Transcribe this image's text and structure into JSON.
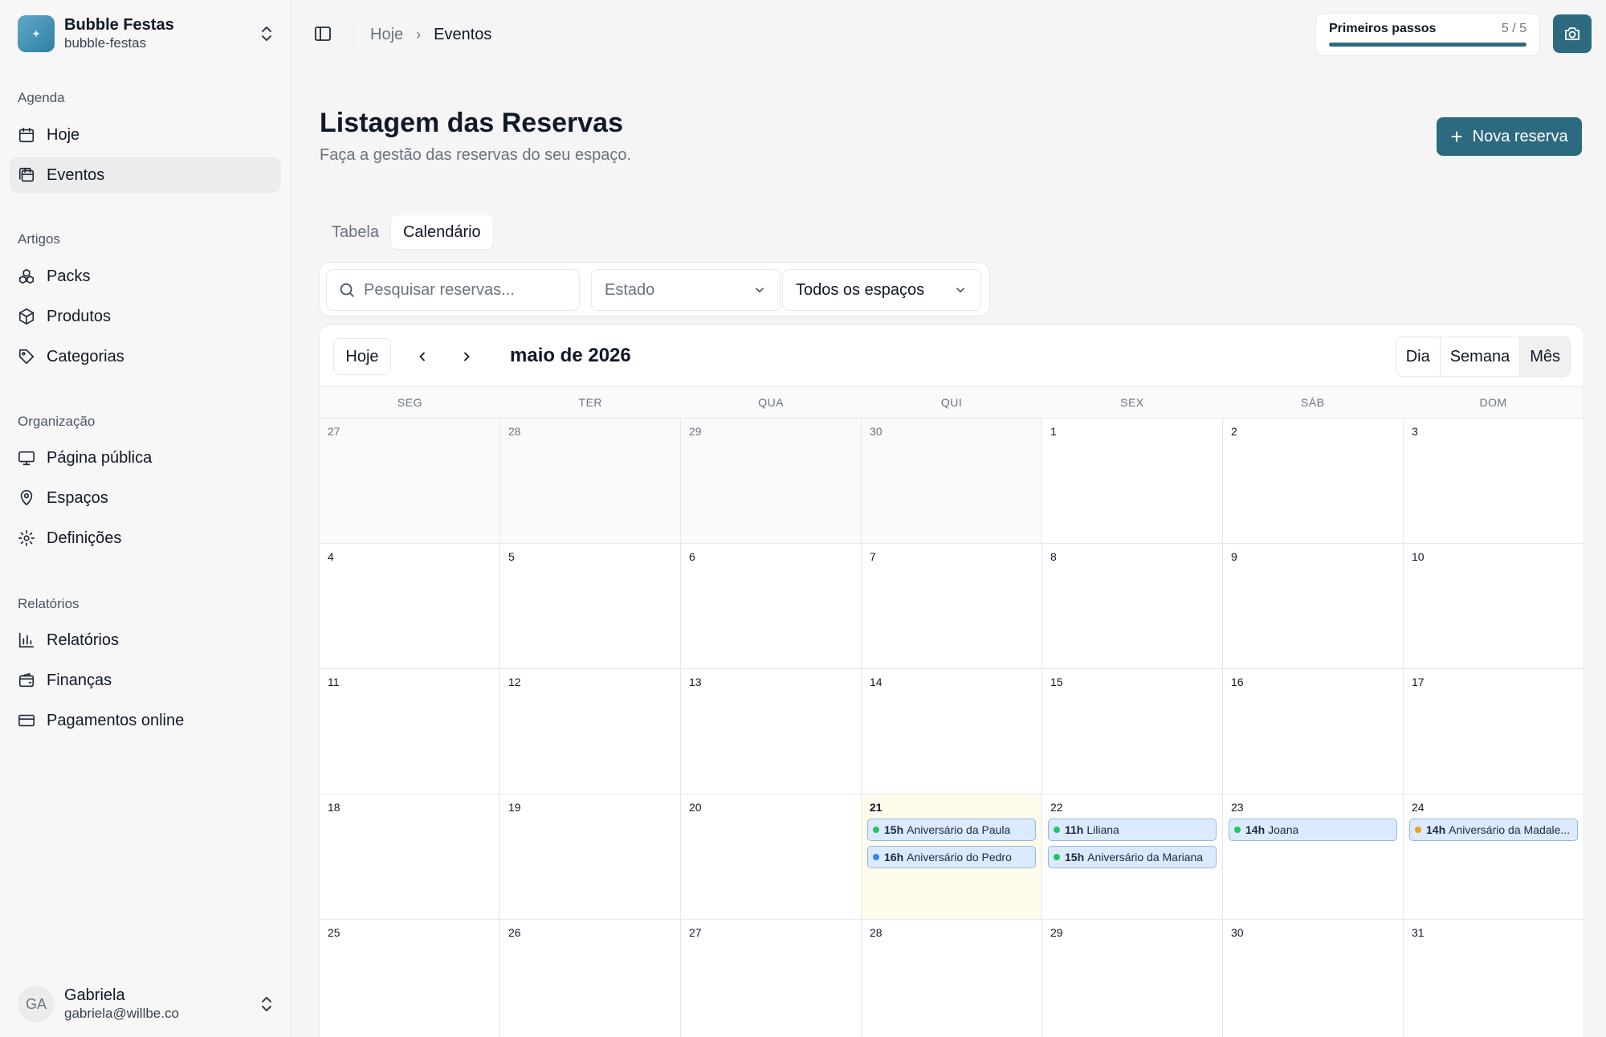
{
  "org": {
    "name": "Bubble Festas",
    "slug": "bubble-festas"
  },
  "sidebar": {
    "sections": [
      {
        "title": "Agenda",
        "items": [
          {
            "label": "Hoje",
            "icon": "calendar-icon"
          },
          {
            "label": "Eventos",
            "icon": "events-icon"
          }
        ]
      },
      {
        "title": "Artigos",
        "items": [
          {
            "label": "Packs",
            "icon": "packs-icon"
          },
          {
            "label": "Produtos",
            "icon": "box-icon"
          },
          {
            "label": "Categorias",
            "icon": "tag-icon"
          }
        ]
      },
      {
        "title": "Organização",
        "items": [
          {
            "label": "Página pública",
            "icon": "monitor-icon"
          },
          {
            "label": "Espaços",
            "icon": "location-icon"
          },
          {
            "label": "Definições",
            "icon": "gear-icon"
          }
        ]
      },
      {
        "title": "Relatórios",
        "items": [
          {
            "label": "Relatórios",
            "icon": "bar-chart-icon"
          },
          {
            "label": "Finanças",
            "icon": "wallet-icon"
          },
          {
            "label": "Pagamentos online",
            "icon": "credit-card-icon"
          }
        ]
      }
    ]
  },
  "user": {
    "initials": "GA",
    "name": "Gabriela",
    "email": "gabriela@willbe.co"
  },
  "breadcrumb": {
    "parent": "Hoje",
    "current": "Eventos"
  },
  "onboarding": {
    "label": "Primeiros passos",
    "count": "5 / 5",
    "progress": 1.0
  },
  "header": {
    "title": "Listagem das Reservas",
    "subtitle": "Faça a gestão das reservas do seu espaço.",
    "new_button": "Nova reserva"
  },
  "tabs": [
    {
      "label": "Tabela",
      "active": false
    },
    {
      "label": "Calendário",
      "active": true
    }
  ],
  "filters": {
    "search_placeholder": "Pesquisar reservas...",
    "state": "Estado",
    "space": "Todos os espaços"
  },
  "calendar": {
    "today_label": "Hoje",
    "month_label": "maio de 2026",
    "views": [
      {
        "label": "Dia",
        "active": false
      },
      {
        "label": "Semana",
        "active": false
      },
      {
        "label": "Mês",
        "active": true
      }
    ],
    "weekdays": [
      "SEG",
      "TER",
      "QUA",
      "QUI",
      "SEX",
      "SÁB",
      "DOM"
    ],
    "weeks": [
      [
        {
          "n": "27",
          "outside": true
        },
        {
          "n": "28",
          "outside": true
        },
        {
          "n": "29",
          "outside": true
        },
        {
          "n": "30",
          "outside": true
        },
        {
          "n": "1"
        },
        {
          "n": "2"
        },
        {
          "n": "3"
        }
      ],
      [
        {
          "n": "4"
        },
        {
          "n": "5"
        },
        {
          "n": "6"
        },
        {
          "n": "7"
        },
        {
          "n": "8"
        },
        {
          "n": "9"
        },
        {
          "n": "10"
        }
      ],
      [
        {
          "n": "11"
        },
        {
          "n": "12"
        },
        {
          "n": "13"
        },
        {
          "n": "14"
        },
        {
          "n": "15"
        },
        {
          "n": "16"
        },
        {
          "n": "17"
        }
      ],
      [
        {
          "n": "18"
        },
        {
          "n": "19"
        },
        {
          "n": "20"
        },
        {
          "n": "21",
          "today": true,
          "events": [
            {
              "time": "15h",
              "title": "Aniversário da Paula",
              "dot": "#22c55e"
            },
            {
              "time": "16h",
              "title": "Aniversário do Pedro",
              "dot": "#3b82f6"
            }
          ]
        },
        {
          "n": "22",
          "events": [
            {
              "time": "11h",
              "title": "Liliana",
              "dot": "#22c55e"
            },
            {
              "time": "15h",
              "title": "Aniversário da Mariana",
              "dot": "#22c55e"
            }
          ]
        },
        {
          "n": "23",
          "events": [
            {
              "time": "14h",
              "title": "Joana",
              "dot": "#22c55e"
            }
          ]
        },
        {
          "n": "24",
          "events": [
            {
              "time": "14h",
              "title": "Aniversário da Madale...",
              "dot": "#f59e0b"
            }
          ]
        }
      ],
      [
        {
          "n": "25"
        },
        {
          "n": "26"
        },
        {
          "n": "27"
        },
        {
          "n": "28"
        },
        {
          "n": "29"
        },
        {
          "n": "30"
        },
        {
          "n": "31"
        }
      ]
    ]
  },
  "colors": {
    "accent": "#2d6a80",
    "today_bg": "#fffbeb",
    "event_bg": "#dbeafe",
    "event_border": "#93b9dd"
  }
}
